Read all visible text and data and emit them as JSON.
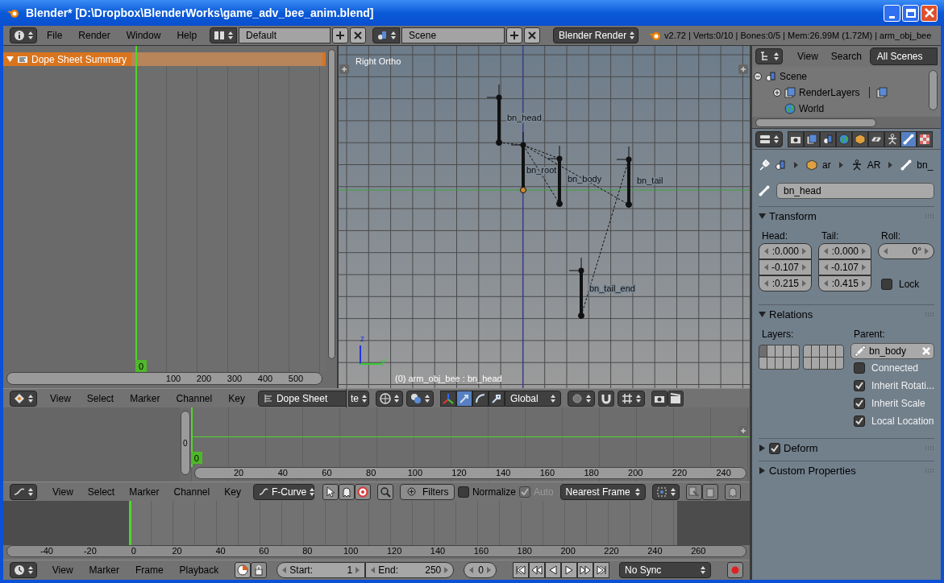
{
  "window": {
    "title": "Blender* [D:\\Dropbox\\BlenderWorks\\game_adv_bee_anim.blend]"
  },
  "top_header": {
    "menus": [
      "File",
      "Render",
      "Window",
      "Help"
    ],
    "layout": "Default",
    "scene": "Scene",
    "engine": "Blender Render",
    "stats": "v2.72 | Verts:0/10 | Bones:0/5 | Mem:26.99M (1.72M) | arm_obj_bee"
  },
  "dope_sheet": {
    "channels": [
      {
        "label": "Dope Sheet Summary",
        "expanded": true,
        "selected": true
      }
    ],
    "current_frame": "0",
    "ruler": [
      "100",
      "200",
      "300",
      "400",
      "500"
    ]
  },
  "viewport": {
    "view_label": "Right Ortho",
    "object_info": "(0) arm_obj_bee : bn_head",
    "axis_labels": [
      "z",
      "y"
    ],
    "bones": [
      {
        "name": "bn_head"
      },
      {
        "name": "bn_root"
      },
      {
        "name": "bn_body"
      },
      {
        "name": "bn_tail"
      },
      {
        "name": "bn_tail_end"
      }
    ]
  },
  "dope_sheet_header": {
    "menus": [
      "View",
      "Select",
      "Marker",
      "Channel",
      "Key"
    ],
    "mode": "Dope Sheet"
  },
  "view3d_header": {
    "cut_text": "te",
    "manipulators": [
      {
        "selected": false
      },
      {
        "selected": true
      },
      {
        "selected": false
      },
      {
        "selected": false
      }
    ],
    "orientation": "Global"
  },
  "graph_editor": {
    "channel_value": "0",
    "current_frame": "0",
    "ruler": [
      "20",
      "40",
      "60",
      "80",
      "100",
      "120",
      "140",
      "160",
      "180",
      "200",
      "220",
      "240"
    ]
  },
  "graph_header": {
    "menus": [
      "View",
      "Select",
      "Marker",
      "Channel",
      "Key"
    ],
    "mode": "F-Curve",
    "filters": "Filters",
    "normalize": {
      "label": "Normalize",
      "checked": false
    },
    "auto": {
      "label": "Auto",
      "checked": true,
      "disabled": true
    },
    "snap": "Nearest Frame"
  },
  "timeline": {
    "ruler": [
      "-40",
      "-20",
      "0",
      "20",
      "40",
      "60",
      "80",
      "100",
      "120",
      "140",
      "160",
      "180",
      "200",
      "220",
      "240",
      "260"
    ]
  },
  "timeline_header": {
    "menus": [
      "View",
      "Marker",
      "Frame",
      "Playback"
    ],
    "start": {
      "label": "Start:",
      "value": "1"
    },
    "end": {
      "label": "End:",
      "value": "250"
    },
    "frame": "0",
    "sync": "No Sync"
  },
  "outliner": {
    "menus": [
      "View",
      "Search"
    ],
    "filter": "All Scenes",
    "tree": [
      {
        "label": "Scene",
        "kind": "scene",
        "expanded": true,
        "children": [
          {
            "label": "RenderLayers",
            "kind": "renderlayers",
            "expanded": false
          },
          {
            "label": "World",
            "kind": "world"
          }
        ]
      }
    ]
  },
  "properties": {
    "tabs": [
      {
        "kind": "render",
        "selected": false
      },
      {
        "kind": "layers",
        "selected": false
      },
      {
        "kind": "scene",
        "selected": false
      },
      {
        "kind": "world",
        "selected": false
      },
      {
        "kind": "object",
        "selected": false
      },
      {
        "kind": "constraints",
        "selected": false
      },
      {
        "kind": "armature",
        "selected": false
      },
      {
        "kind": "bone",
        "selected": true
      },
      {
        "kind": "texture",
        "selected": false
      }
    ],
    "breadcrumb": [
      {
        "kind": "scene"
      },
      {
        "kind": "object",
        "label": "ar"
      },
      {
        "kind": "armature",
        "label": "AR"
      },
      {
        "kind": "bone",
        "label": "bn_"
      }
    ],
    "bone_name": "bn_head",
    "transform": {
      "title": "Transform",
      "expanded": true,
      "head_label": "Head:",
      "head": [
        ":0.000",
        "-0.107",
        ":0.215"
      ],
      "tail_label": "Tail:",
      "tail": [
        ":0.000",
        "-0.107",
        ":0.415"
      ],
      "roll_label": "Roll:",
      "roll": "0°",
      "lock": {
        "label": "Lock",
        "checked": false
      }
    },
    "relations": {
      "title": "Relations",
      "expanded": true,
      "layers_label": "Layers:",
      "layers": [
        {
          "on": true
        },
        {
          "on": false
        },
        {
          "on": false
        },
        {
          "on": false
        },
        {
          "on": false
        },
        {
          "on": false
        },
        {
          "on": false
        },
        {
          "on": false
        },
        {
          "on": false
        },
        {
          "on": false
        },
        {
          "on": false
        },
        {
          "on": false
        },
        {
          "on": false
        },
        {
          "on": false
        },
        {
          "on": false
        },
        {
          "on": false
        },
        {
          "on": false
        },
        {
          "on": false
        },
        {
          "on": false
        },
        {
          "on": false
        }
      ],
      "parent_label": "Parent:",
      "parent": "bn_body",
      "options": [
        {
          "label": "Connected",
          "checked": false
        },
        {
          "label": "Inherit Rotati...",
          "checked": true
        },
        {
          "label": "Inherit Scale",
          "checked": true
        },
        {
          "label": "Local Location",
          "checked": true
        }
      ]
    },
    "deform": {
      "title": "Deform",
      "expanded": false,
      "checked": true
    },
    "custom_properties": {
      "title": "Custom Properties",
      "expanded": false
    }
  }
}
